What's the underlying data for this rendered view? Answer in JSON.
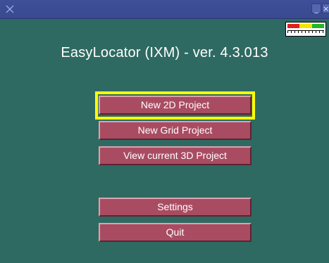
{
  "window": {
    "title_icon": "app-logo-icon",
    "minimize_label": "_",
    "close_label": "×"
  },
  "app": {
    "title": "EasyLocator (IXM) - ver. 4.3.013"
  },
  "meter": {
    "icon": "signal-meter-icon",
    "colors": [
      "#e02020",
      "#f2e600",
      "#23b52a"
    ]
  },
  "menu": {
    "new_2d": "New 2D Project",
    "new_grid": "New Grid Project",
    "view_3d": "View current 3D Project",
    "settings": "Settings",
    "quit": "Quit"
  },
  "colors": {
    "background": "#2f6a62",
    "button": "#a94c62",
    "focus": "#ffff00",
    "titlebar": "#3f4f98"
  }
}
